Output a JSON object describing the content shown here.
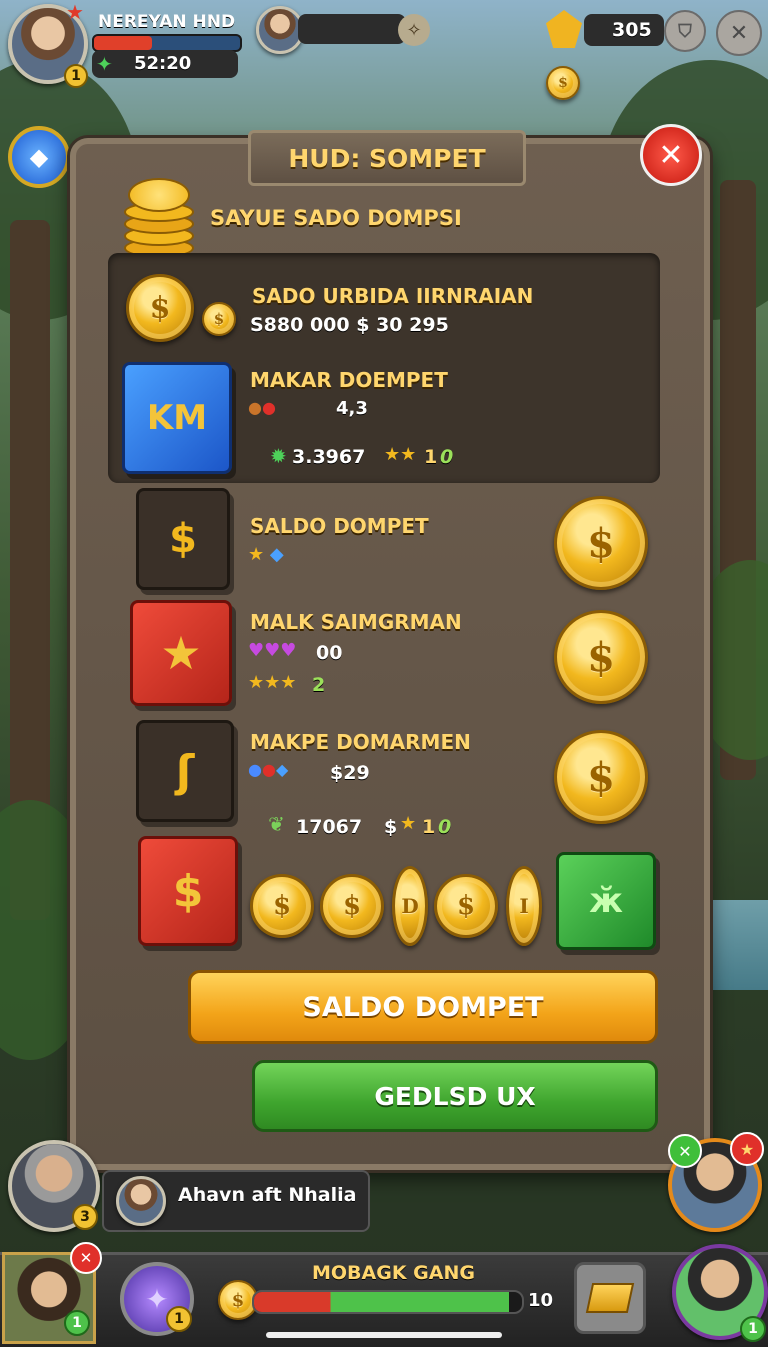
{
  "player": {
    "name": "NEREYAN HND",
    "level": "1",
    "timer": "52:20"
  },
  "top": {
    "currency_value": "305"
  },
  "panel": {
    "title": "HUD: SOMPET",
    "subtitle": "SAYUE SADO DOMPSI",
    "rows": [
      {
        "title": "SADO URBIDA IIRNRAIAN",
        "line1": "S880 000  $ 30 295"
      },
      {
        "title": "MAKAR DOEMPET",
        "line1": "4,3",
        "line2": "3.3967",
        "line2b": "1",
        "line2c": "0"
      },
      {
        "title": "SALDO DOMPET"
      },
      {
        "title": "MALK SAIMGRMAN",
        "line1": "00",
        "line2": "2"
      },
      {
        "title": "MAKPE DOMARMEN",
        "line1": "$29",
        "line2": "17067",
        "line2b": "$",
        "line2c": "1",
        "line2d": "0"
      }
    ],
    "coin_row_letters": [
      "$",
      "$",
      "D",
      "$",
      "I"
    ],
    "primary_button": "SALDO DOMPET",
    "secondary_button": "GEDLSD UX"
  },
  "chat": {
    "message": "Ahavn aft Nhalia",
    "level": "3"
  },
  "bottom": {
    "title": "MOBAGK GANG",
    "value": "10",
    "left_level": "1",
    "gem_level": "1",
    "right_level": "1",
    "progress": 0.95
  }
}
